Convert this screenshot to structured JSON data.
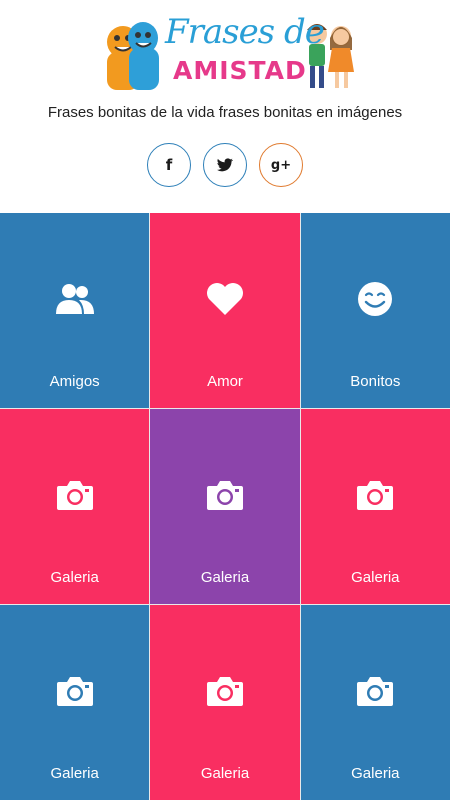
{
  "header": {
    "logo_title": "Frases de",
    "logo_subtitle": "AMISTAD",
    "tagline": "Frases bonitas de la vida frases bonitas en imágenes"
  },
  "social": [
    {
      "name": "facebook-icon",
      "glyph": "f"
    },
    {
      "name": "twitter-icon",
      "glyph": ""
    },
    {
      "name": "google-plus-icon",
      "glyph": "g+"
    }
  ],
  "colors": {
    "blue": "#2f7cb4",
    "pink": "#f92e61",
    "purple": "#8c44ab"
  },
  "tiles": [
    {
      "label": "Amigos",
      "icon": "users-icon",
      "color": "#2f7cb4"
    },
    {
      "label": "Amor",
      "icon": "heart-icon",
      "color": "#f92e61"
    },
    {
      "label": "Bonitos",
      "icon": "smile-icon",
      "color": "#2f7cb4"
    },
    {
      "label": "Galeria",
      "icon": "camera-icon",
      "color": "#f92e61"
    },
    {
      "label": "Galeria",
      "icon": "camera-icon",
      "color": "#8c44ab"
    },
    {
      "label": "Galeria",
      "icon": "camera-icon",
      "color": "#f92e61"
    },
    {
      "label": "Galeria",
      "icon": "camera-icon",
      "color": "#2f7cb4"
    },
    {
      "label": "Galeria",
      "icon": "camera-icon",
      "color": "#f92e61"
    },
    {
      "label": "Galeria",
      "icon": "camera-icon",
      "color": "#2f7cb4"
    }
  ]
}
